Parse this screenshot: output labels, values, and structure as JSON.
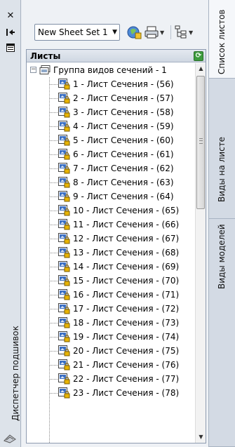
{
  "palette": {
    "title": "Диспетчер подшивок",
    "close_icon": "close-icon",
    "autohide_icon": "autohide-icon",
    "properties_icon": "properties-icon",
    "bottom_icon": "sheetset-manager-icon"
  },
  "toolbar": {
    "sheet_set_selected": "New Sheet Set 1",
    "buttons": [
      {
        "name": "publish-button",
        "icon": "publish-icon"
      },
      {
        "name": "plot-button",
        "icon": "plot-icon"
      },
      {
        "name": "views-button",
        "icon": "tree-view-icon"
      }
    ]
  },
  "panel": {
    "title": "Листы",
    "refresh_icon": "refresh-icon",
    "refresh_glyph": "⟳"
  },
  "tree": {
    "root_label": "Группа видов сечений - 1",
    "sheets": [
      "1 - Лист Сечения - (56)",
      "2 - Лист Сечения - (57)",
      "3 - Лист Сечения - (58)",
      "4 - Лист Сечения - (59)",
      "5 - Лист Сечения - (60)",
      "6 - Лист Сечения - (61)",
      "7 - Лист Сечения - (62)",
      "8 - Лист Сечения - (63)",
      "9 - Лист Сечения - (64)",
      "10 - Лист Сечения - (65)",
      "11 - Лист Сечения - (66)",
      "12 - Лист Сечения - (67)",
      "13 - Лист Сечения - (68)",
      "14 - Лист Сечения - (69)",
      "15 - Лист Сечения - (70)",
      "16 - Лист Сечения - (71)",
      "17 - Лист Сечения - (72)",
      "18 - Лист Сечения - (73)",
      "19 - Лист Сечения - (74)",
      "20 - Лист Сечения - (75)",
      "21 - Лист Сечения - (76)",
      "22 - Лист Сечения - (77)",
      "23 - Лист Сечения - (78)"
    ]
  },
  "tabs": [
    {
      "label": "Список листов",
      "active": true
    },
    {
      "label": "Виды на листе",
      "active": false
    },
    {
      "label": "Виды моделей",
      "active": false
    }
  ],
  "colors": {
    "icon_blue": "#3a6fc4",
    "lock_yellow": "#e8b400",
    "refresh_green": "#3c9b3c"
  }
}
